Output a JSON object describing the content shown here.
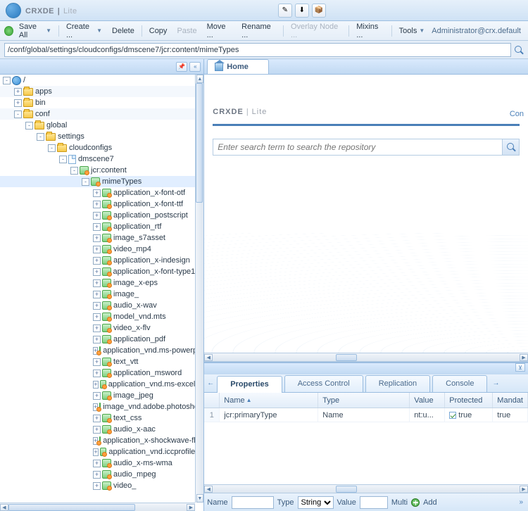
{
  "app": {
    "title_a": "CRXDE",
    "title_b": "Lite",
    "user": "Administrator@crx.default"
  },
  "toolbar": {
    "save_all": "Save All",
    "create": "Create ...",
    "delete": "Delete",
    "copy": "Copy",
    "paste": "Paste",
    "move": "Move ...",
    "rename": "Rename ...",
    "overlay": "Overlay Node ...",
    "mixins": "Mixins ...",
    "tools": "Tools"
  },
  "path": "/conf/global/settings/cloudconfigs/dmscene7/jcr:content/mimeTypes",
  "tree": [
    {
      "d": 0,
      "ic": "globe",
      "exp": "-",
      "label": "/"
    },
    {
      "d": 1,
      "ic": "folder",
      "exp": "+",
      "label": "apps",
      "stripe": true
    },
    {
      "d": 1,
      "ic": "folder",
      "exp": "+",
      "label": "bin"
    },
    {
      "d": 1,
      "ic": "folder",
      "exp": "-",
      "label": "conf",
      "stripe": true
    },
    {
      "d": 2,
      "ic": "folder",
      "exp": "-",
      "label": "global"
    },
    {
      "d": 3,
      "ic": "folder",
      "exp": "-",
      "label": "settings"
    },
    {
      "d": 4,
      "ic": "folder",
      "exp": "-",
      "label": "cloudconfigs"
    },
    {
      "d": 5,
      "ic": "page",
      "exp": "-",
      "label": "dmscene7"
    },
    {
      "d": 6,
      "ic": "node",
      "exp": "-",
      "label": "jcr:content"
    },
    {
      "d": 7,
      "ic": "node",
      "exp": "-",
      "label": "mimeTypes",
      "sel": true
    },
    {
      "d": 8,
      "ic": "node",
      "exp": "+",
      "label": "application_x-font-otf"
    },
    {
      "d": 8,
      "ic": "node",
      "exp": "+",
      "label": "application_x-font-ttf"
    },
    {
      "d": 8,
      "ic": "node",
      "exp": "+",
      "label": "application_postscript"
    },
    {
      "d": 8,
      "ic": "node",
      "exp": "+",
      "label": "application_rtf"
    },
    {
      "d": 8,
      "ic": "node",
      "exp": "+",
      "label": "image_s7asset"
    },
    {
      "d": 8,
      "ic": "node",
      "exp": "+",
      "label": "video_mp4"
    },
    {
      "d": 8,
      "ic": "node",
      "exp": "+",
      "label": "application_x-indesign"
    },
    {
      "d": 8,
      "ic": "node",
      "exp": "+",
      "label": "application_x-font-type1"
    },
    {
      "d": 8,
      "ic": "node",
      "exp": "+",
      "label": "image_x-eps"
    },
    {
      "d": 8,
      "ic": "node",
      "exp": "+",
      "label": "image_"
    },
    {
      "d": 8,
      "ic": "node",
      "exp": "+",
      "label": "audio_x-wav"
    },
    {
      "d": 8,
      "ic": "node",
      "exp": "+",
      "label": "model_vnd.mts"
    },
    {
      "d": 8,
      "ic": "node",
      "exp": "+",
      "label": "video_x-flv"
    },
    {
      "d": 8,
      "ic": "node",
      "exp": "+",
      "label": "application_pdf"
    },
    {
      "d": 8,
      "ic": "node",
      "exp": "+",
      "label": "application_vnd.ms-powerpoin"
    },
    {
      "d": 8,
      "ic": "node",
      "exp": "+",
      "label": "text_vtt"
    },
    {
      "d": 8,
      "ic": "node",
      "exp": "+",
      "label": "application_msword"
    },
    {
      "d": 8,
      "ic": "node",
      "exp": "+",
      "label": "application_vnd.ms-excel"
    },
    {
      "d": 8,
      "ic": "node",
      "exp": "+",
      "label": "image_jpeg"
    },
    {
      "d": 8,
      "ic": "node",
      "exp": "+",
      "label": "image_vnd.adobe.photoshop"
    },
    {
      "d": 8,
      "ic": "node",
      "exp": "+",
      "label": "text_css"
    },
    {
      "d": 8,
      "ic": "node",
      "exp": "+",
      "label": "audio_x-aac"
    },
    {
      "d": 8,
      "ic": "node",
      "exp": "+",
      "label": "application_x-shockwave-flas"
    },
    {
      "d": 8,
      "ic": "node",
      "exp": "+",
      "label": "application_vnd.iccprofile"
    },
    {
      "d": 8,
      "ic": "node",
      "exp": "+",
      "label": "audio_x-ms-wma"
    },
    {
      "d": 8,
      "ic": "node",
      "exp": "+",
      "label": "audio_mpeg"
    },
    {
      "d": 8,
      "ic": "node",
      "exp": "+",
      "label": "video_"
    }
  ],
  "home": {
    "tab": "Home",
    "search_placeholder": "Enter search term to search the repository",
    "conf": "Con"
  },
  "btabs": {
    "properties": "Properties",
    "access": "Access Control",
    "replication": "Replication",
    "console": "Console"
  },
  "grid": {
    "headers": {
      "name": "Name",
      "type": "Type",
      "value": "Value",
      "protected": "Protected",
      "mandatory": "Mandat"
    },
    "rows": [
      {
        "num": "1",
        "name": "jcr:primaryType",
        "type": "Name",
        "value": "nt:u...",
        "protected": "true",
        "mandatory": "true"
      }
    ]
  },
  "bbar": {
    "name": "Name",
    "type": "Type",
    "typeval": "String",
    "value": "Value",
    "multi": "Multi",
    "add": "Add"
  }
}
